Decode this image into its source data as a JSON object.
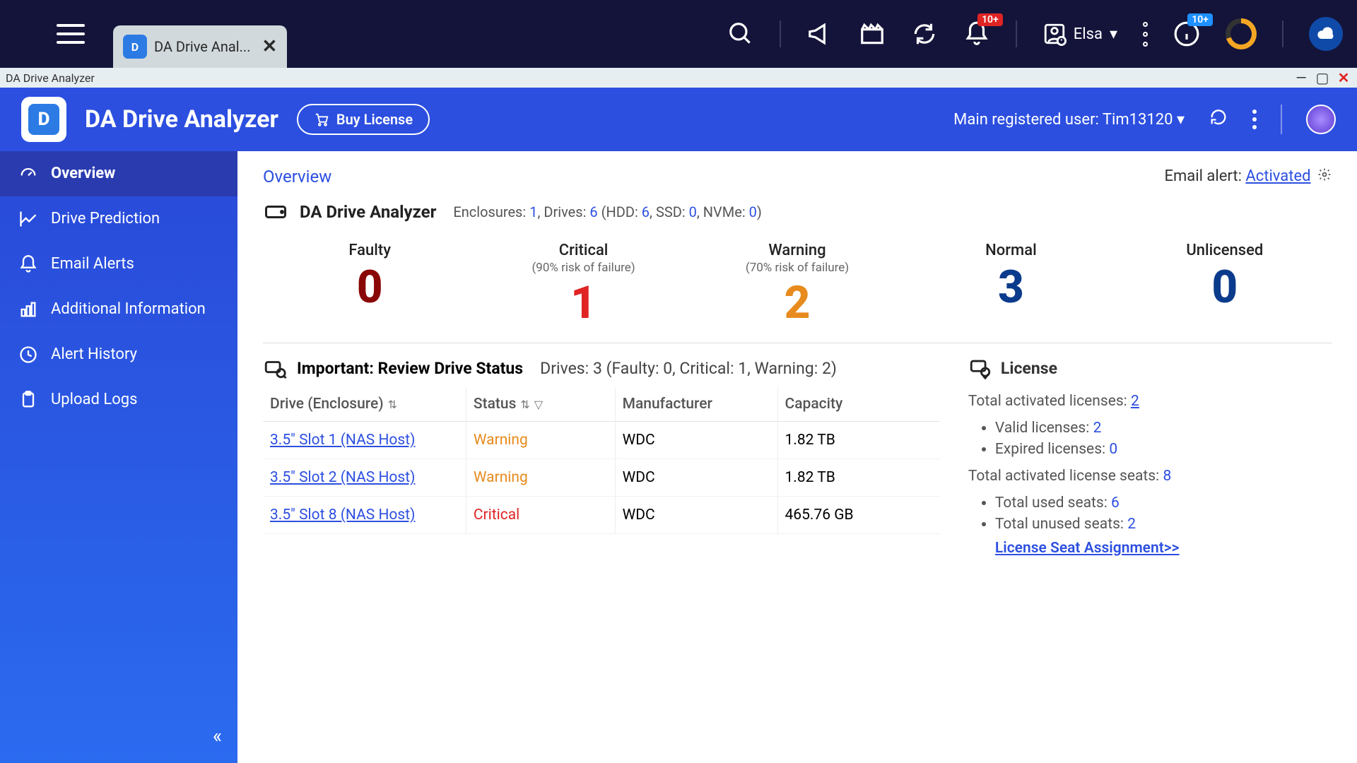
{
  "sysbar": {
    "tab_title": "DA Drive Anal...",
    "notif_badge": "10+",
    "info_badge": "10+",
    "username": "Elsa"
  },
  "window": {
    "title": "DA Drive Analyzer"
  },
  "header": {
    "app_name": "DA Drive Analyzer",
    "buy_label": "Buy License",
    "registered_prefix": "Main registered user: ",
    "registered_user": "Tim13120"
  },
  "sidebar": {
    "items": [
      {
        "label": "Overview"
      },
      {
        "label": "Drive Prediction"
      },
      {
        "label": "Email Alerts"
      },
      {
        "label": "Additional Information"
      },
      {
        "label": "Alert History"
      },
      {
        "label": "Upload Logs"
      }
    ]
  },
  "main": {
    "breadcrumb": "Overview",
    "email_alert_label": "Email alert: ",
    "email_alert_status": "Activated",
    "analyzer_title": "DA Drive Analyzer",
    "enclosure_summary": {
      "enclosures_label": "Enclosures: ",
      "enclosures": "1",
      "drives_label": ", Drives: ",
      "drives": "6",
      "hdd_label": " (HDD: ",
      "hdd": "6",
      "ssd_label": ", SSD: ",
      "ssd": "0",
      "nvme_label": ", NVMe: ",
      "nvme": "0",
      "close": ")"
    },
    "stats": {
      "faulty": {
        "label": "Faulty",
        "sub": "",
        "value": "0"
      },
      "critical": {
        "label": "Critical",
        "sub": "(90% risk of failure)",
        "value": "1"
      },
      "warning": {
        "label": "Warning",
        "sub": "(70% risk of failure)",
        "value": "2"
      },
      "normal": {
        "label": "Normal",
        "sub": "",
        "value": "3"
      },
      "unlicensed": {
        "label": "Unlicensed",
        "sub": "",
        "value": "0"
      }
    },
    "review": {
      "title": "Important: Review Drive Status",
      "meta": "Drives: 3 (Faulty: 0, Critical: 1, Warning: 2)",
      "columns": {
        "drive": "Drive (Enclosure)",
        "status": "Status",
        "manufacturer": "Manufacturer",
        "capacity": "Capacity"
      },
      "rows": [
        {
          "drive": "3.5\" Slot 1 (NAS Host)",
          "status": "Warning",
          "status_class": "st-warning",
          "manufacturer": "WDC",
          "capacity": "1.82 TB"
        },
        {
          "drive": "3.5\" Slot 2 (NAS Host)",
          "status": "Warning",
          "status_class": "st-warning",
          "manufacturer": "WDC",
          "capacity": "1.82 TB"
        },
        {
          "drive": "3.5\" Slot 8 (NAS Host)",
          "status": "Critical",
          "status_class": "st-critical",
          "manufacturer": "WDC",
          "capacity": "465.76 GB"
        }
      ]
    },
    "license": {
      "title": "License",
      "total_activated_label": "Total activated licenses: ",
      "total_activated": "2",
      "valid_label": "Valid licenses: ",
      "valid": "2",
      "expired_label": "Expired licenses: ",
      "expired": "0",
      "seats_label": "Total activated license seats: ",
      "seats": "8",
      "used_label": "Total used seats: ",
      "used": "6",
      "unused_label": "Total unused seats: ",
      "unused": "2",
      "seat_link": "License Seat Assignment>>"
    }
  }
}
